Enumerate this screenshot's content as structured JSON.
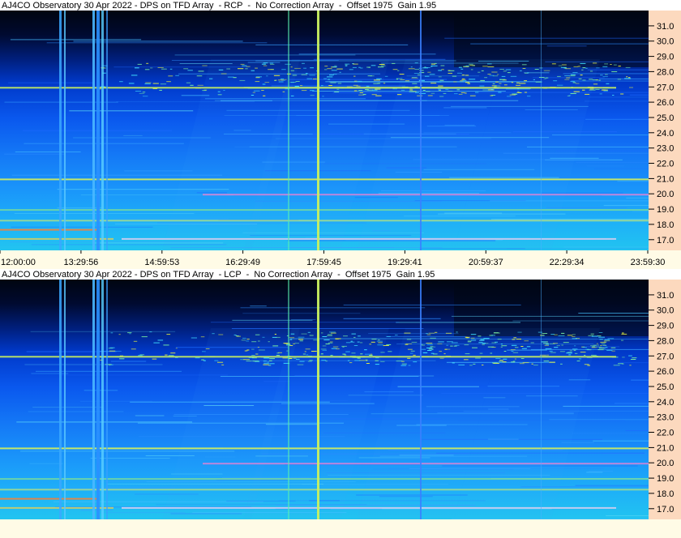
{
  "panels": [
    {
      "title": "AJ4CO Observatory 30 Apr 2022 - DPS on TFD Array  - RCP  -  No Correction Array  -  Offset 1975  Gain 1.95"
    },
    {
      "title": "AJ4CO Observatory 30 Apr 2022 - DPS on TFD Array  - LCP  -  No Correction Array  -  Offset 1975  Gain 1.95"
    }
  ],
  "colors": {
    "background": "#000814",
    "axis_panel": "#fcd9be",
    "time_bar": "#fffbe6"
  },
  "chart_data": [
    {
      "type": "heatmap",
      "title": "AJ4CO Observatory 30 Apr 2022 - DPS on TFD Array  - RCP  -  No Correction Array  -  Offset 1975  Gain 1.95",
      "x_tick_labels": [
        "12:00:00",
        "13:29:56",
        "14:59:53",
        "16:29:49",
        "17:59:45",
        "19:29:41",
        "20:59:37",
        "22:29:34",
        "23:59:30"
      ],
      "y_tick_labels": [
        "17.0",
        "18.0",
        "19.0",
        "20.0",
        "21.0",
        "22.0",
        "23.0",
        "24.0",
        "25.0",
        "26.0",
        "27.0",
        "28.0",
        "29.0",
        "30.0",
        "31.0"
      ],
      "y_ticks": [
        17,
        18,
        19,
        20,
        21,
        22,
        23,
        24,
        25,
        26,
        27,
        28,
        29,
        30,
        31
      ],
      "ylim": [
        16.3,
        32.0
      ],
      "xlim_hours": [
        12.0,
        23.99
      ]
    },
    {
      "type": "heatmap",
      "title": "AJ4CO Observatory 30 Apr 2022 - DPS on TFD Array  - LCP  -  No Correction Array  -  Offset 1975  Gain 1.95",
      "y_tick_labels": [
        "17.0",
        "18.0",
        "19.0",
        "20.0",
        "21.0",
        "22.0",
        "23.0",
        "24.0",
        "25.0",
        "26.0",
        "27.0",
        "28.0",
        "29.0",
        "30.0",
        "31.0"
      ],
      "y_ticks": [
        17,
        18,
        19,
        20,
        21,
        22,
        23,
        24,
        25,
        26,
        27,
        28,
        29,
        30,
        31
      ],
      "ylim": [
        16.3,
        32.0
      ],
      "xlim_hours": [
        12.0,
        23.99
      ]
    }
  ]
}
